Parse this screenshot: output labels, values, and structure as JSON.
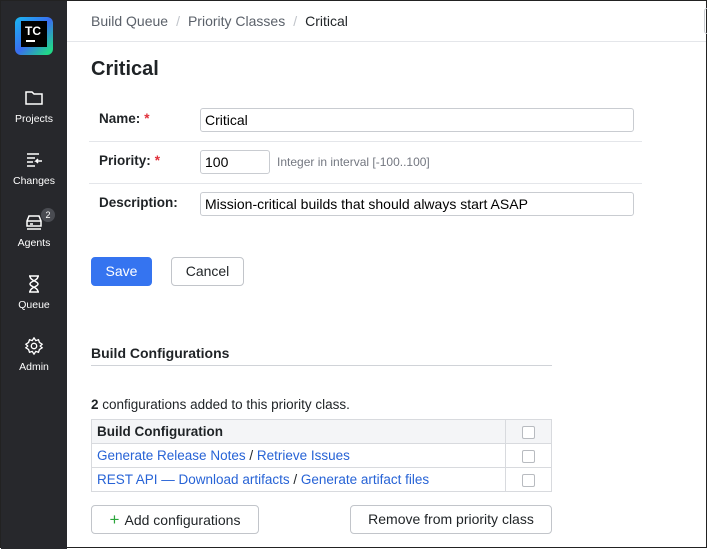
{
  "sidebar": {
    "logo": "TC",
    "items": [
      {
        "label": "Projects"
      },
      {
        "label": "Changes"
      },
      {
        "label": "Agents",
        "badge": "2"
      },
      {
        "label": "Queue"
      },
      {
        "label": "Admin"
      }
    ]
  },
  "breadcrumb": [
    "Build Queue",
    "Priority Classes",
    "Critical"
  ],
  "title": "Critical",
  "form": {
    "name_label": "Name:",
    "name_value": "Critical",
    "priority_label": "Priority:",
    "priority_value": "100",
    "priority_hint": "Integer in interval [-100..100]",
    "description_label": "Description:",
    "description_value": "Mission-critical builds that should always start ASAP",
    "required_mark": "*"
  },
  "buttons": {
    "save": "Save",
    "cancel": "Cancel",
    "add": "Add configurations",
    "remove": "Remove from priority class"
  },
  "configs": {
    "heading": "Build Configurations",
    "count": "2",
    "count_text": " configurations added to this priority class.",
    "column": "Build Configuration",
    "rows": [
      {
        "project": "Generate Release Notes",
        "config": "Retrieve Issues"
      },
      {
        "project": "REST API — Download artifacts",
        "config": "Generate artifact files"
      }
    ],
    "separator": " / "
  }
}
